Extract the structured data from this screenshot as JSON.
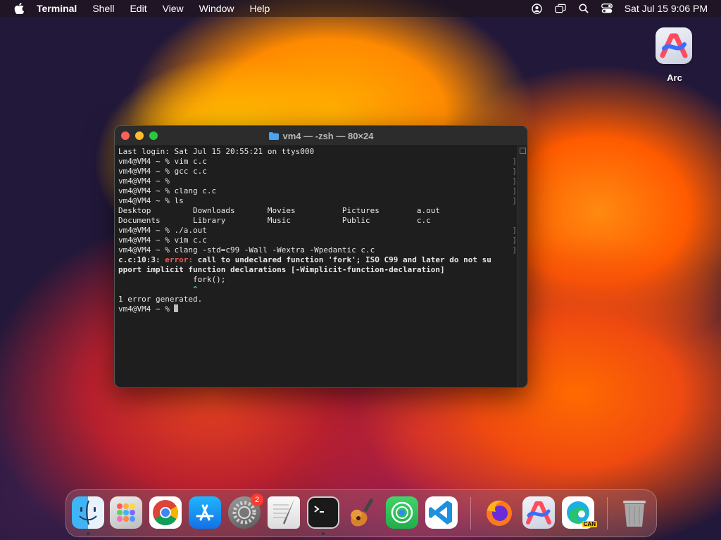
{
  "menubar": {
    "app_name": "Terminal",
    "items": [
      "Shell",
      "Edit",
      "View",
      "Window",
      "Help"
    ],
    "clock": "Sat Jul 15  9:06 PM",
    "icons": [
      "apple-icon",
      "user-icon",
      "screen-mirroring-icon",
      "search-icon",
      "control-center-icon"
    ]
  },
  "desktop": {
    "icons": [
      {
        "label": "Arc",
        "icon": "arc-icon"
      }
    ]
  },
  "terminal": {
    "title": "vm4 — -zsh — 80×24",
    "lines": [
      {
        "t": "Last login: Sat Jul 15 20:55:21 on ttys000"
      },
      {
        "t": "vm4@VM4 ~ % vim c.c",
        "mark": true
      },
      {
        "t": "vm4@VM4 ~ % gcc c.c",
        "mark": true
      },
      {
        "t": "vm4@VM4 ~ %",
        "mark": true
      },
      {
        "t": "vm4@VM4 ~ % clang c.c",
        "mark": true
      },
      {
        "t": "vm4@VM4 ~ % ls",
        "mark": true
      },
      {
        "t": "Desktop         Downloads       Movies          Pictures        a.out"
      },
      {
        "t": "Documents       Library         Music           Public          c.c"
      },
      {
        "t": "vm4@VM4 ~ % ./a.out",
        "mark": true
      },
      {
        "t": "vm4@VM4 ~ % vim c.c",
        "mark": true
      },
      {
        "t": "vm4@VM4 ~ % clang -std=c99 -Wall -Wextra -Wpedantic c.c",
        "mark": true
      }
    ],
    "error": {
      "location": "c.c:10:3: ",
      "label": "error:",
      "message": " call to undeclared function 'fork'; ISO C99 and later do not su",
      "message2": "pport implicit function declarations [-Wimplicit-function-declaration]",
      "code": "                fork();",
      "caret": "                ^"
    },
    "summary": "1 error generated.",
    "prompt": "vm4@VM4 ~ % "
  },
  "dock": {
    "apps": [
      {
        "name": "Finder",
        "icon": "finder-icon",
        "running": true
      },
      {
        "name": "Launchpad",
        "icon": "launchpad-icon"
      },
      {
        "name": "Google Chrome",
        "icon": "chrome-icon"
      },
      {
        "name": "App Store",
        "icon": "app-store-icon"
      },
      {
        "name": "System Settings",
        "icon": "settings-icon",
        "badge": "2"
      },
      {
        "name": "TextEdit",
        "icon": "textedit-icon"
      },
      {
        "name": "Terminal",
        "icon": "terminal-icon",
        "running": true
      },
      {
        "name": "GarageBand",
        "icon": "garageband-icon"
      },
      {
        "name": "Find My",
        "icon": "findmy-icon"
      },
      {
        "name": "Visual Studio Code",
        "icon": "vscode-icon"
      },
      {
        "name": "Firefox",
        "icon": "firefox-icon"
      },
      {
        "name": "Arc",
        "icon": "arc-icon"
      },
      {
        "name": "Microsoft Edge Canary",
        "icon": "edge-canary-icon",
        "tag": "CAN"
      },
      {
        "name": "Trash",
        "icon": "trash-icon"
      }
    ]
  }
}
